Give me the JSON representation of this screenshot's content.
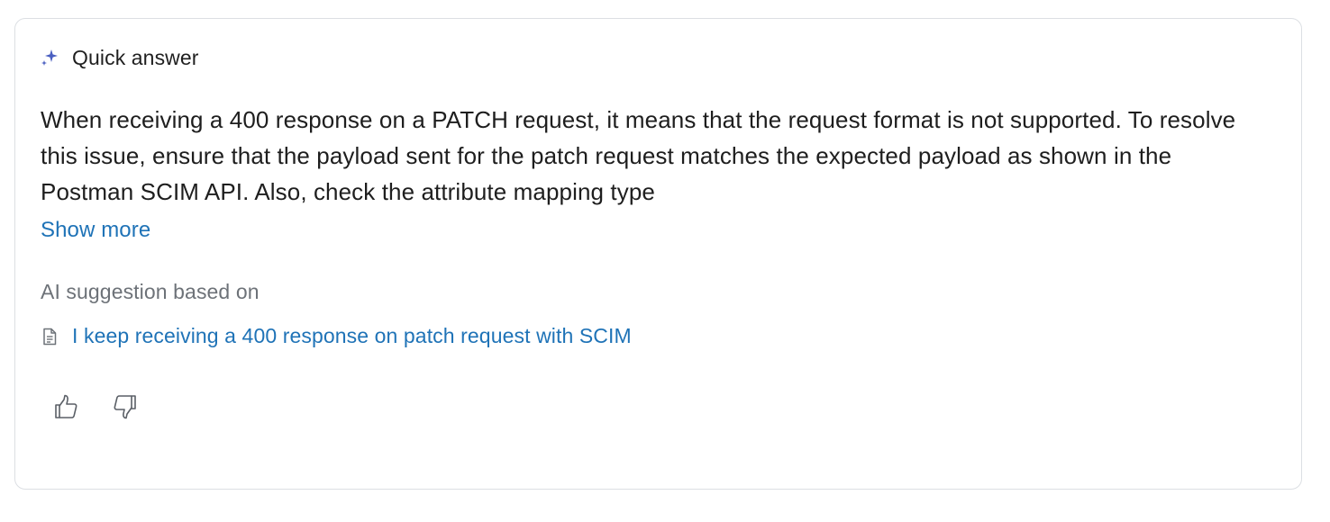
{
  "header": {
    "icon": "sparkle-icon",
    "title": "Quick answer",
    "accent_color": "#4a5fc1"
  },
  "answer": {
    "text": "When receiving a 400 response on a PATCH request, it means that the request format is not supported. To resolve this issue, ensure that the payload sent for the patch request matches the expected payload as shown in the Postman SCIM API. Also, check the attribute mapping type",
    "show_more_label": "Show more"
  },
  "sources": {
    "label": "AI suggestion based on",
    "items": [
      {
        "icon": "document-icon",
        "title": "I keep receiving a 400 response on patch request with SCIM"
      }
    ]
  },
  "feedback": {
    "thumbs_up_icon": "thumbs-up-icon",
    "thumbs_down_icon": "thumbs-down-icon"
  },
  "colors": {
    "link": "#1f73b7",
    "muted": "#6d7278",
    "border": "#dcdfe3"
  }
}
